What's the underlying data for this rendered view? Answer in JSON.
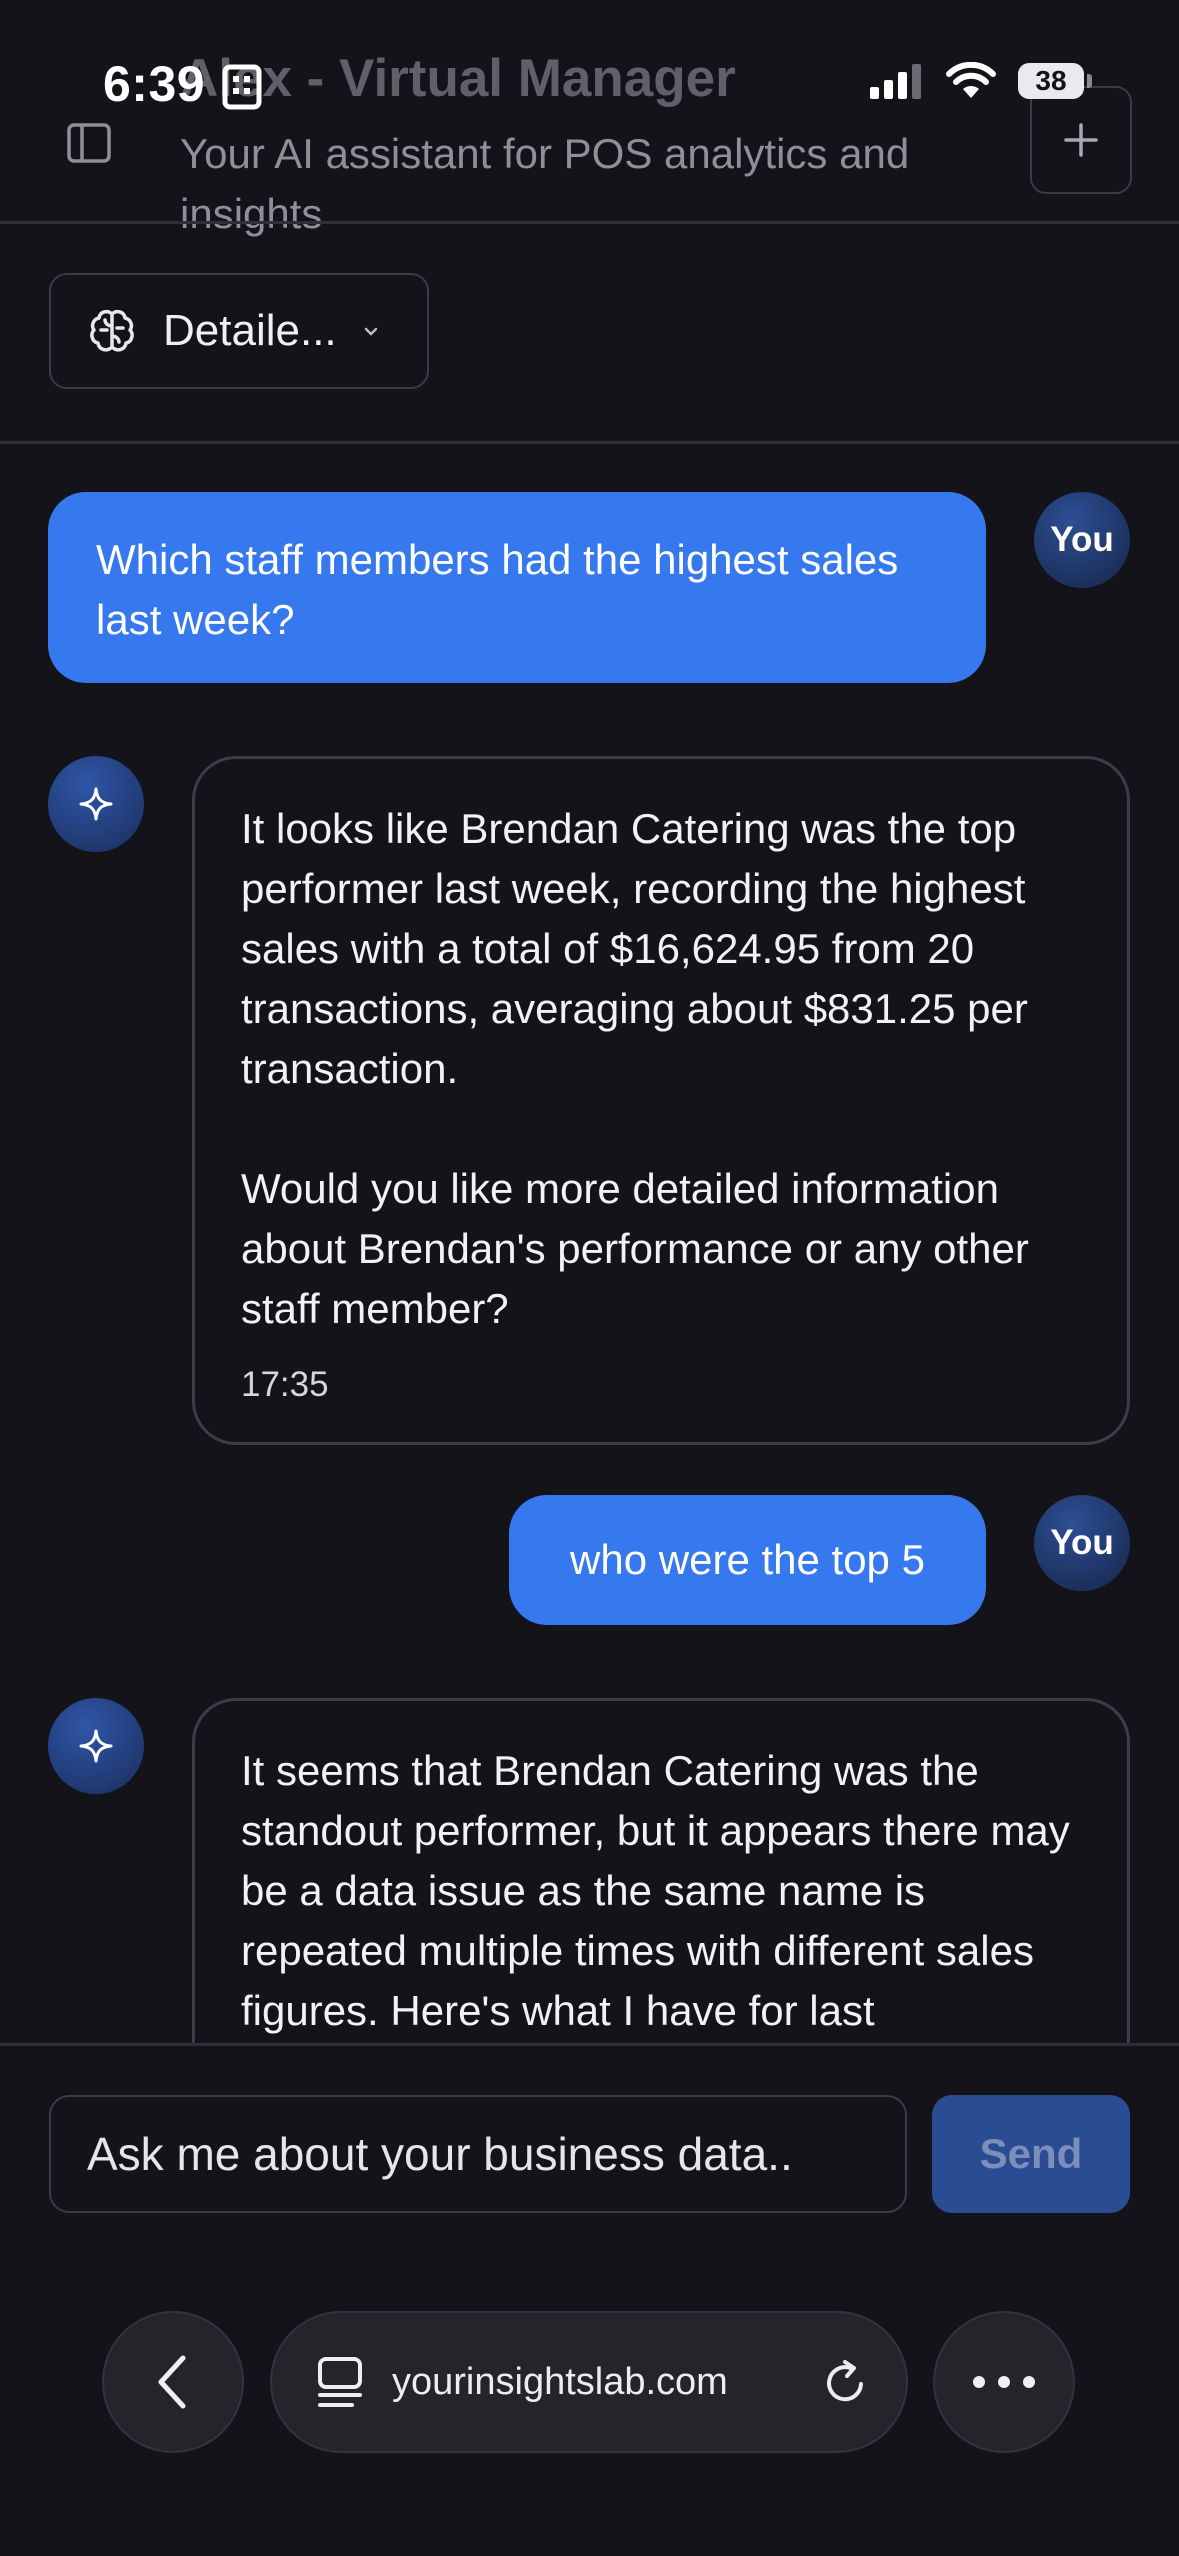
{
  "status_bar": {
    "time": "6:39",
    "battery": "38"
  },
  "header": {
    "title": "Alex - Virtual Manager",
    "subtitle": "Your AI assistant for POS analytics and insights"
  },
  "mode_select": {
    "selected": "Detaile..."
  },
  "messages": [
    {
      "role": "user",
      "avatar": "You",
      "text": "Which staff members had the highest sales last week?"
    },
    {
      "role": "assistant",
      "paragraphs": [
        "It looks like Brendan Catering was the top performer last week, recording the highest sales with a total of $16,624.95 from 20 transactions, averaging about $831.25 per transaction.",
        "Would you like more detailed information about Brendan's performance or any other staff member?"
      ],
      "time": "17:35"
    },
    {
      "role": "user",
      "avatar": "You",
      "text": "who were the top 5"
    },
    {
      "role": "assistant",
      "paragraphs": [
        "It seems that Brendan Catering was the standout performer, but it appears there may be a data issue as the same name is repeated multiple times with different sales figures. Here's what I have for last"
      ]
    }
  ],
  "composer": {
    "placeholder": "Ask me about your business data..",
    "send_label": "Send"
  },
  "browser": {
    "url": "yourinsightslab.com"
  },
  "icons": {
    "sidebar": "sidebar-icon",
    "plus": "plus-icon",
    "brain": "brain-icon",
    "chevron": "chevron-down-icon",
    "sparkle": "sparkle-icon",
    "back": "chevron-left-icon",
    "tabs": "tabs-icon",
    "reload": "reload-icon",
    "more": "more-icon"
  },
  "colors": {
    "background": "#131319",
    "user_bubble": "#3678ee",
    "send_button": "#2a4c93"
  }
}
